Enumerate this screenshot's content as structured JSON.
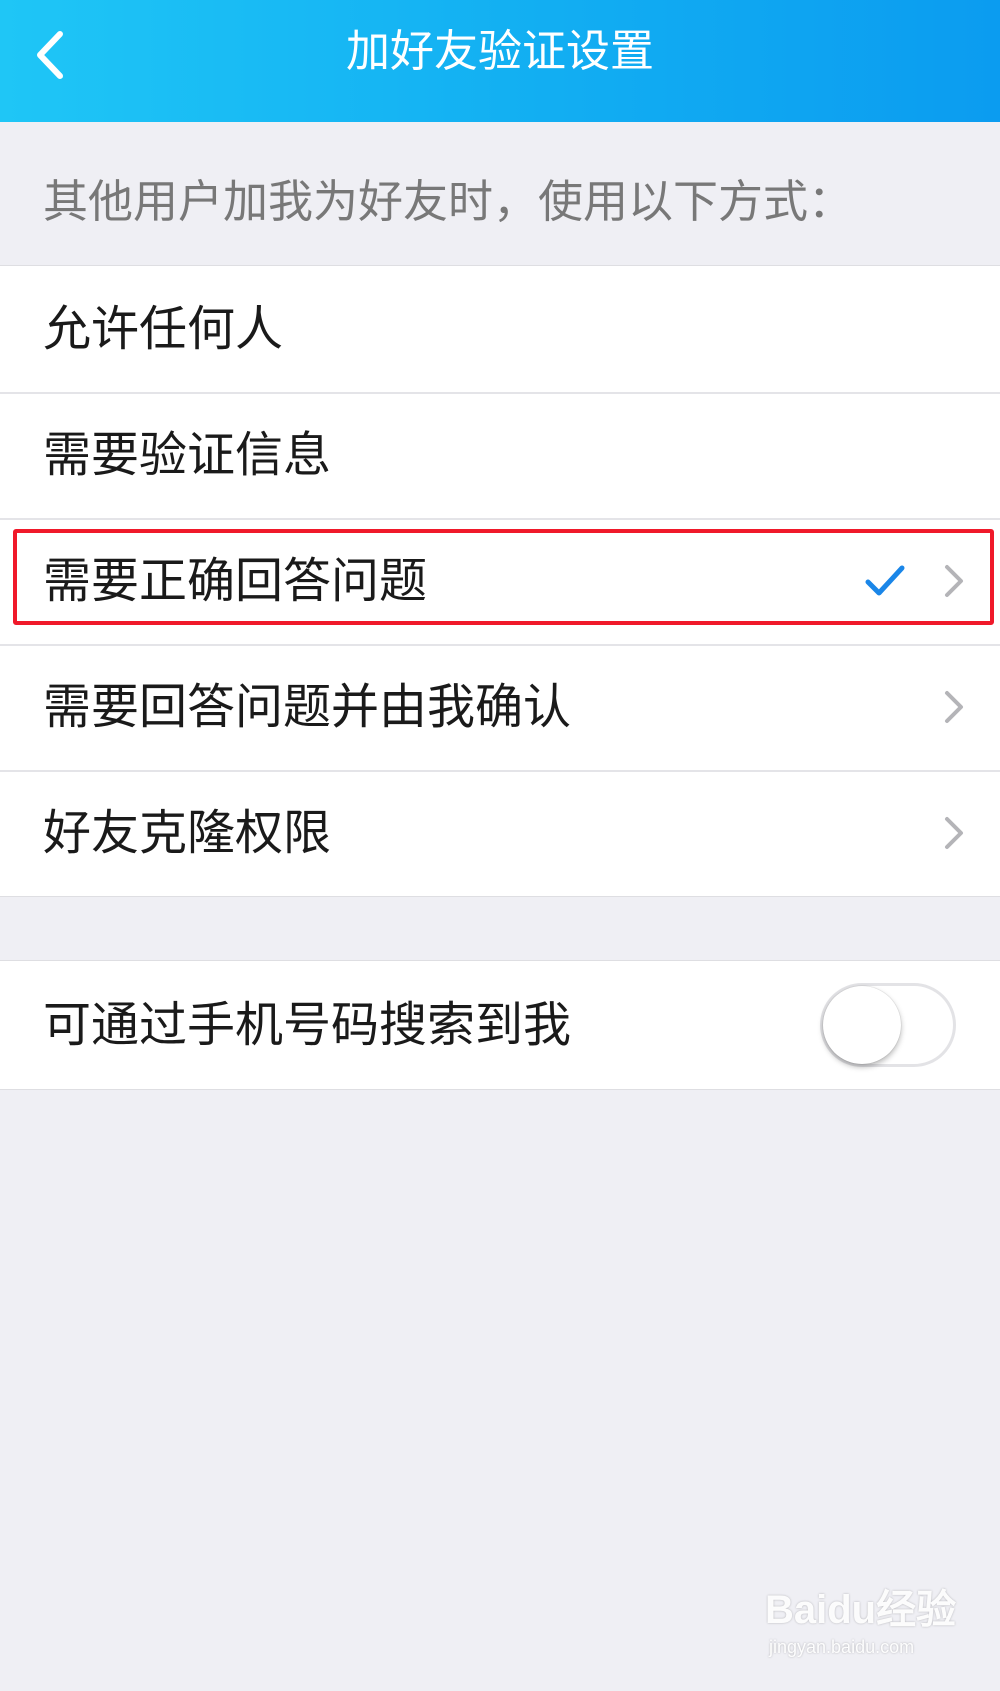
{
  "colors": {
    "header_gradient_start": "#1fc6f6",
    "header_gradient_end": "#0b9cf0",
    "page_background": "#efeff4",
    "check_color": "#1a86e8",
    "highlight_border": "#f0192a",
    "hint_text": "#787878"
  },
  "header": {
    "title": "加好友验证设置",
    "back_icon": "chevron-left-icon"
  },
  "hint": "其他用户加我为好友时，使用以下方式：",
  "options": [
    {
      "label": "允许任何人",
      "selected": false,
      "has_chevron": false
    },
    {
      "label": "需要验证信息",
      "selected": false,
      "has_chevron": false
    },
    {
      "label": "需要正确回答问题",
      "selected": true,
      "has_chevron": true,
      "highlighted": true
    },
    {
      "label": "需要回答问题并由我确认",
      "selected": false,
      "has_chevron": true
    },
    {
      "label": "好友克隆权限",
      "selected": false,
      "has_chevron": true
    }
  ],
  "phone_search": {
    "label": "可通过手机号码搜索到我",
    "enabled": false
  },
  "watermark": {
    "logo": "Baidu经验",
    "url": "jingyan.baidu.com"
  }
}
